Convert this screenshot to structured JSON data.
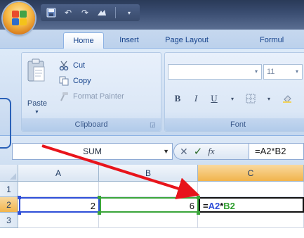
{
  "quick_access": {
    "icons": [
      "save-icon",
      "undo-icon",
      "redo-icon",
      "insert-shape-icon",
      "customize-icon"
    ]
  },
  "tabs": [
    {
      "label": "Home",
      "active": true
    },
    {
      "label": "Insert",
      "active": false
    },
    {
      "label": "Page Layout",
      "active": false
    },
    {
      "label": "Formul",
      "active": false
    }
  ],
  "clipboard": {
    "paste": "Paste",
    "cut": "Cut",
    "copy": "Copy",
    "format_painter": "Format Painter",
    "label": "Clipboard"
  },
  "font": {
    "size": "11",
    "bold": "B",
    "italic": "I",
    "underline": "U",
    "label": "Font"
  },
  "formula_bar": {
    "name_box": "SUM",
    "fx": "fx",
    "formula": "=A2*B2"
  },
  "grid": {
    "columns": [
      "A",
      "B",
      "C"
    ],
    "active_column": "C",
    "rows": [
      "1",
      "2",
      "3"
    ],
    "active_row": "2",
    "cells": {
      "A2": "2",
      "B2": "6",
      "C2": {
        "eq": "=",
        "ref1": "A2",
        "op": "*",
        "ref2": "B2"
      }
    }
  },
  "colors": {
    "annotation_arrow": "#e8141b",
    "ref_a": "#2f4fd8",
    "ref_b": "#2f9e2f",
    "active_header": "#f1b44c"
  }
}
